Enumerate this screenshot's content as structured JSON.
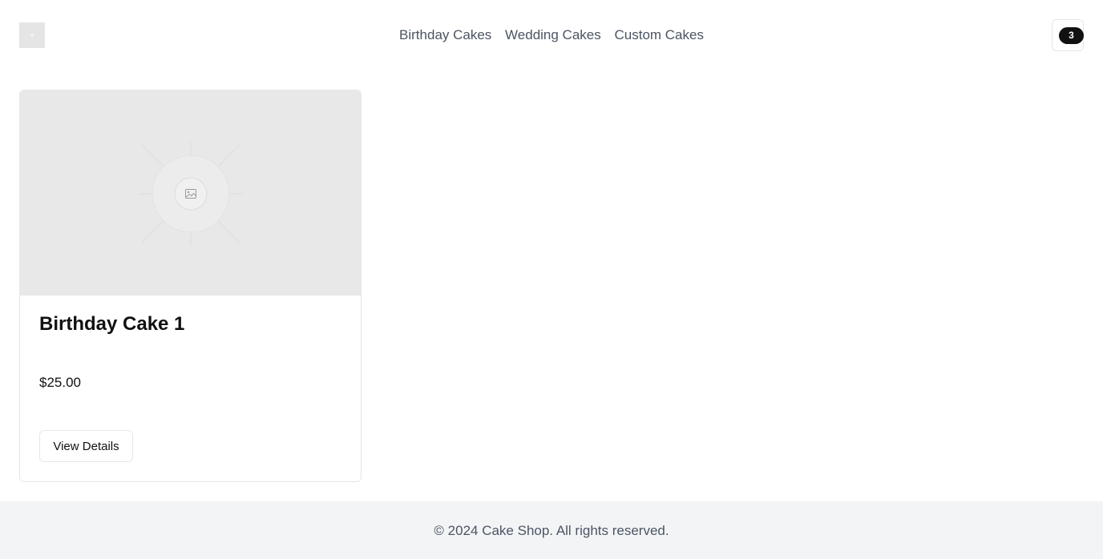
{
  "header": {
    "logo_icon": "logo-placeholder-icon",
    "nav": [
      {
        "label": "Birthday Cakes"
      },
      {
        "label": "Wedding Cakes"
      },
      {
        "label": "Custom Cakes"
      }
    ],
    "cart": {
      "icon": "cart-icon",
      "count": "3"
    }
  },
  "products": [
    {
      "image_icon": "image-placeholder-icon",
      "title": "Birthday Cake 1",
      "price": "$25.00",
      "button_label": "View Details"
    }
  ],
  "footer": {
    "text": "© 2024 Cake Shop. All rights reserved."
  },
  "colors": {
    "background": "#ffffff",
    "border": "#e5e7eb",
    "nav_text": "#4b5563",
    "badge": "#111111",
    "image_placeholder": "#e8e8e8",
    "footer_bg": "#f3f4f6"
  }
}
